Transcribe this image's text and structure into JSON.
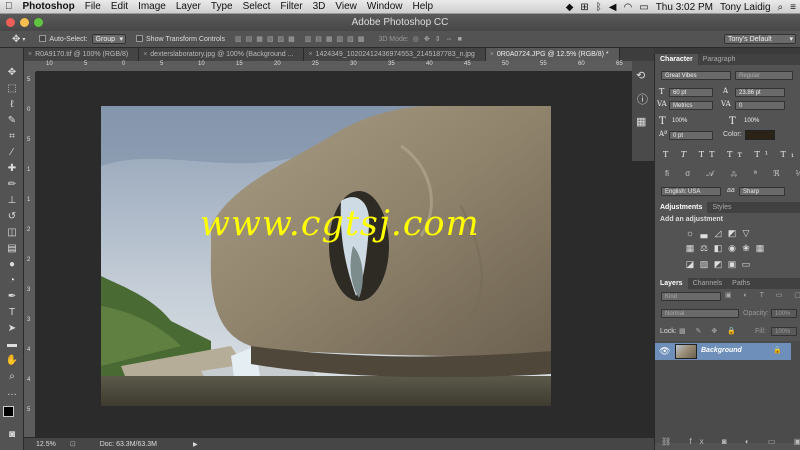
{
  "menubar": {
    "app": "Photoshop",
    "items": [
      "File",
      "Edit",
      "Image",
      "Layer",
      "Type",
      "Select",
      "Filter",
      "3D",
      "View",
      "Window",
      "Help"
    ],
    "clock": "Thu 3:02 PM",
    "user": "Tony Laidig"
  },
  "window": {
    "title": "Adobe Photoshop CC"
  },
  "options": {
    "auto_select_label": "Auto-Select:",
    "auto_select_value": "Group",
    "transform_label": "Show Transform Controls",
    "mode_label": "3D Mode:",
    "workspace": "Tony's Default"
  },
  "tabs": [
    {
      "label": "R0A9170.tif @ 100% (RGB/8)"
    },
    {
      "label": "dexterslaboratory.jpg @ 100% (Background ..."
    },
    {
      "label": "1424349_10202412436974553_2145187783_n.jpg"
    },
    {
      "label": "0R0A0724.JPG @ 12.5% (RGB/8) *"
    }
  ],
  "rulers": {
    "h": [
      "10",
      "5",
      "0",
      "5",
      "10",
      "15",
      "20",
      "25",
      "30",
      "35",
      "40",
      "45",
      "50",
      "55",
      "60",
      "65"
    ],
    "v": [
      "5",
      "0",
      "5",
      "1",
      "1",
      "2",
      "2",
      "3",
      "3",
      "4",
      "4",
      "5"
    ]
  },
  "watermark": "www.cgtsj.com",
  "status": {
    "zoom": "12.5%",
    "doc": "Doc: 63.3M/63.3M"
  },
  "character_panel": {
    "tabs": [
      "Character",
      "Paragraph"
    ],
    "font_family": "Great Vibes",
    "font_style": "Regular",
    "size": "60 pt",
    "leading": "23.86 pt",
    "kerning": "Metrics",
    "tracking": "0",
    "vscale": "100%",
    "hscale": "100%",
    "baseline": "0 pt",
    "color_label": "Color:",
    "language": "English: USA",
    "aa_label": "aa",
    "antialias": "Sharp"
  },
  "adjustments_panel": {
    "tabs": [
      "Adjustments",
      "Styles"
    ],
    "heading": "Add an adjustment"
  },
  "layers_panel": {
    "tabs": [
      "Layers",
      "Channels",
      "Paths"
    ],
    "filter": "Kind",
    "blend_mode": "Normal",
    "opacity_label": "Opacity:",
    "opacity": "100%",
    "lock_label": "Lock:",
    "fill_label": "Fill:",
    "fill": "100%",
    "layers": [
      {
        "name": "Background"
      }
    ]
  },
  "colors": {
    "accent": "#6d8fb9",
    "watermark": "#ffff00"
  }
}
